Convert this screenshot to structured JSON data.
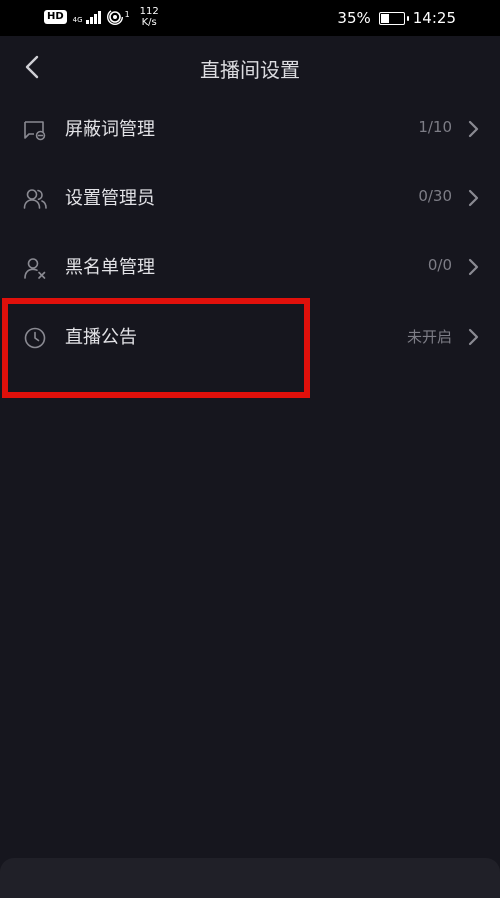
{
  "status_bar": {
    "hd": "HD",
    "network": "4G",
    "wifi_index": "1",
    "speed_value": "112",
    "speed_unit": "K/s",
    "battery_percent": "35%",
    "battery_level": 0.35,
    "time": "14:25"
  },
  "header": {
    "title": "直播间设置",
    "back_icon": "chevron-left-icon"
  },
  "settings": {
    "items": [
      {
        "label": "屏蔽词管理",
        "value": "1/10",
        "icon": "message-block-icon"
      },
      {
        "label": "设置管理员",
        "value": "0/30",
        "icon": "users-icon"
      },
      {
        "label": "黑名单管理",
        "value": "0/0",
        "icon": "user-remove-icon"
      },
      {
        "label": "直播公告",
        "value": "未开启",
        "icon": "clock-icon"
      }
    ]
  },
  "colors": {
    "background": "#16161e",
    "highlight": "#e0100b",
    "secondary_text": "#7d7d86"
  }
}
